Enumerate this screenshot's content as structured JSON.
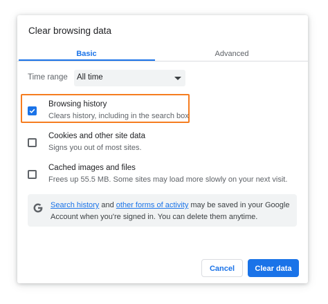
{
  "dialog": {
    "title": "Clear browsing data",
    "tabs": [
      {
        "label": "Basic",
        "active": true
      },
      {
        "label": "Advanced",
        "active": false
      }
    ],
    "time_range": {
      "label": "Time range",
      "selected": "All time"
    },
    "options": [
      {
        "title": "Browsing history",
        "subtitle": "Clears history, including in the search box",
        "checked": true
      },
      {
        "title": "Cookies and other site data",
        "subtitle": "Signs you out of most sites.",
        "checked": false
      },
      {
        "title": "Cached images and files",
        "subtitle": "Frees up 55.5 MB. Some sites may load more slowly on your next visit.",
        "checked": false
      }
    ],
    "info": {
      "icon": "google-g-icon",
      "link1": "Search history",
      "and": " and ",
      "link2": "other forms of activity",
      "text1": " may be saved in your Google",
      "text2": "Account when you're signed in. You can delete them anytime."
    },
    "buttons": {
      "cancel": "Cancel",
      "clear": "Clear data"
    },
    "colors": {
      "accent": "#1a73e8",
      "highlight": "#f57c1f"
    }
  }
}
